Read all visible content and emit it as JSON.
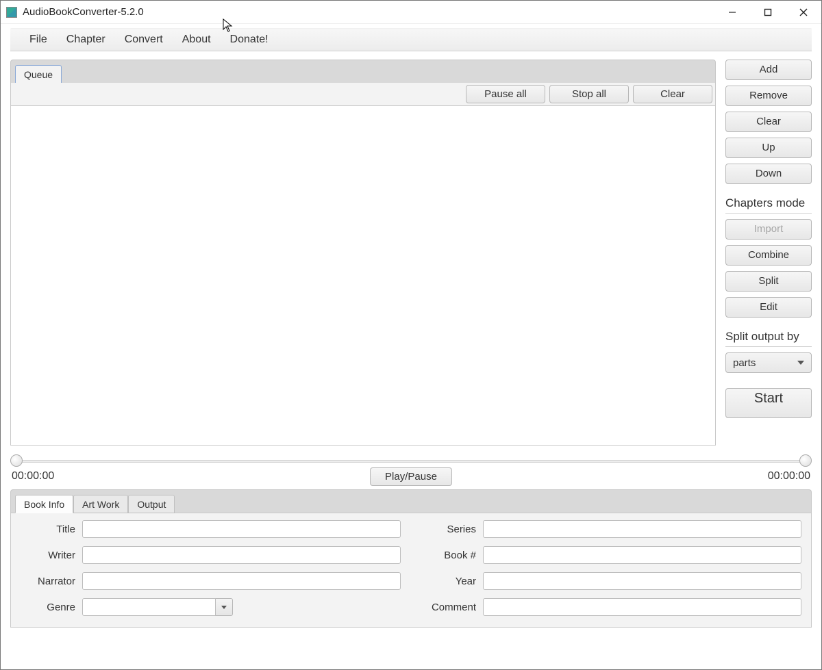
{
  "window": {
    "title": "AudioBookConverter-5.2.0"
  },
  "menu": {
    "file": "File",
    "chapter": "Chapter",
    "convert": "Convert",
    "about": "About",
    "donate": "Donate!"
  },
  "tabs": {
    "queue": "Queue"
  },
  "queue_toolbar": {
    "pause_all": "Pause all",
    "stop_all": "Stop all",
    "clear": "Clear"
  },
  "sidebar": {
    "add": "Add",
    "remove": "Remove",
    "clear": "Clear",
    "up": "Up",
    "down": "Down",
    "chapters_mode_heading": "Chapters mode",
    "import": "Import",
    "combine": "Combine",
    "split": "Split",
    "edit": "Edit",
    "split_output_heading": "Split output by",
    "split_output_value": "parts",
    "start": "Start"
  },
  "playback": {
    "time_left": "00:00:00",
    "time_right": "00:00:00",
    "play_pause": "Play/Pause"
  },
  "bottom_tabs": {
    "book_info": "Book Info",
    "art_work": "Art Work",
    "output": "Output"
  },
  "form": {
    "labels": {
      "title": "Title",
      "writer": "Writer",
      "narrator": "Narrator",
      "genre": "Genre",
      "series": "Series",
      "book_no": "Book #",
      "year": "Year",
      "comment": "Comment"
    },
    "values": {
      "title": "",
      "writer": "",
      "narrator": "",
      "genre": "",
      "series": "",
      "book_no": "",
      "year": "",
      "comment": ""
    }
  }
}
